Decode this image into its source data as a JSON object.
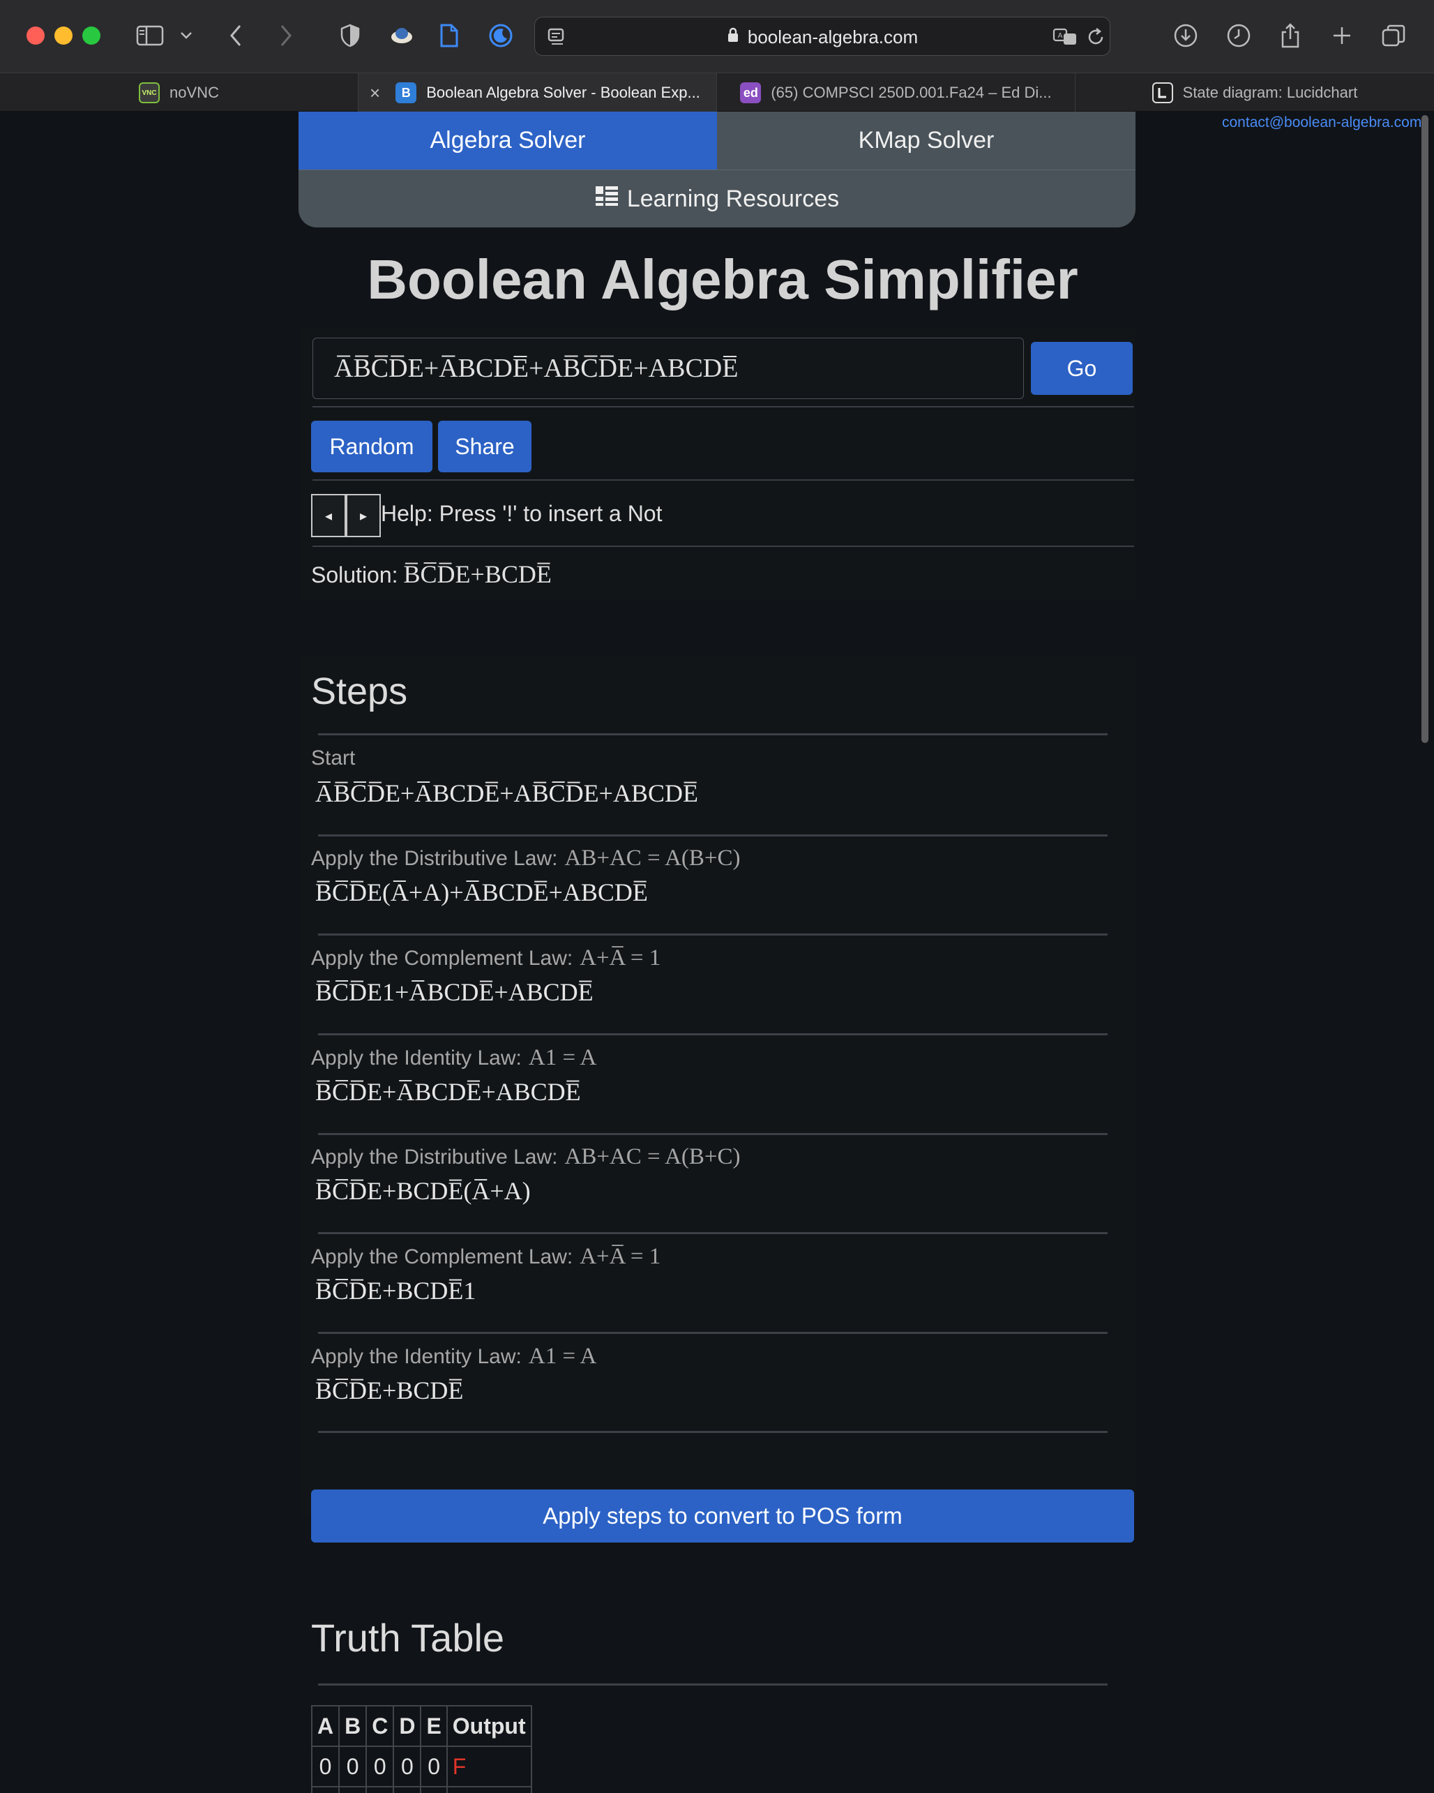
{
  "browser": {
    "url": "boolean-algebra.com",
    "tabs": [
      {
        "label": "noVNC"
      },
      {
        "label": "Boolean Algebra Solver - Boolean Exp..."
      },
      {
        "label": "(65) COMPSCI 250D.001.Fa24 – Ed Di..."
      },
      {
        "label": "State diagram: Lucidchart"
      }
    ],
    "favicons": {
      "vnc": "VNC",
      "boolean": "B",
      "ed": "ed"
    }
  },
  "contact": "contact@boolean-algebra.com",
  "nav": {
    "algebra_solver": "Algebra Solver",
    "kmap_solver": "KMap Solver",
    "learning_resources": "Learning Resources"
  },
  "title": "Boolean Algebra Simplifier",
  "input": {
    "value": "A̅B̅C̅D̅E+A̅BCDE̅+AB̅C̅D̅E+ABCDE̅"
  },
  "buttons": {
    "go": "Go",
    "random": "Random",
    "share": "Share",
    "prev": "◂",
    "next": "▸",
    "pos": "Apply steps to convert to POS form"
  },
  "help": "Help: Press '!' to insert a Not",
  "solution": {
    "label": "Solution:",
    "value": "B̅C̅D̅E+BCDE̅"
  },
  "steps": {
    "heading": "Steps",
    "items": [
      {
        "label": "Start",
        "law": "",
        "expr": "A̅B̅C̅D̅E+A̅BCDE̅+AB̅C̅D̅E+ABCDE̅"
      },
      {
        "label": "Apply the Distributive Law:",
        "law": "AB+AC = A(B+C)",
        "expr": "B̅C̅D̅E(A̅+A)+A̅BCDE̅+ABCDE̅"
      },
      {
        "label": "Apply the Complement Law:",
        "law": "A+A̅ = 1",
        "expr": "B̅C̅D̅E1+A̅BCDE̅+ABCDE̅"
      },
      {
        "label": "Apply the Identity Law:",
        "law": "A1 = A",
        "expr": "B̅C̅D̅E+A̅BCDE̅+ABCDE̅"
      },
      {
        "label": "Apply the Distributive Law:",
        "law": "AB+AC = A(B+C)",
        "expr": "B̅C̅D̅E+BCDE̅(A̅+A)"
      },
      {
        "label": "Apply the Complement Law:",
        "law": "A+A̅ = 1",
        "expr": "B̅C̅D̅E+BCDE̅1"
      },
      {
        "label": "Apply the Identity Law:",
        "law": "A1 = A",
        "expr": "B̅C̅D̅E+BCDE̅"
      }
    ]
  },
  "truth_table": {
    "heading": "Truth Table",
    "columns": [
      "A",
      "B",
      "C",
      "D",
      "E",
      "Output"
    ],
    "rows": [
      [
        "0",
        "0",
        "0",
        "0",
        "0",
        "F"
      ]
    ]
  },
  "colors": {
    "accent": "#2c62c5",
    "nav_inactive": "#4a5359",
    "output_false": "#e0352b",
    "link": "#4a8cf7"
  }
}
